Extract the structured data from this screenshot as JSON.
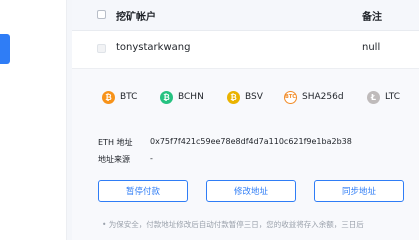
{
  "table": {
    "header": {
      "account": "挖矿帐户",
      "remark": "备注"
    },
    "rows": [
      {
        "account": "tonystarkwang",
        "remark": "null"
      }
    ]
  },
  "coins": [
    {
      "name": "BTC",
      "icon": "bitcoin-icon",
      "color": "#f7931a"
    },
    {
      "name": "BCHN",
      "icon": "bitcoin-cash-icon",
      "color": "#26c281"
    },
    {
      "name": "BSV",
      "icon": "bitcoin-sv-icon",
      "color": "#eab300"
    },
    {
      "name": "SHA256d",
      "icon": "sha256d-icon",
      "color": "#f28c28"
    },
    {
      "name": "LTC",
      "icon": "litecoin-icon",
      "color": "#bfbbbb"
    }
  ],
  "details": {
    "eth_label": "ETH 地址",
    "eth_value": "0x75f7f421c59ee78e8df4d7a110c621f9e1ba2b38",
    "source_label": "地址来源",
    "source_value": "-"
  },
  "buttons": {
    "pause": "暂停付款",
    "modify": "修改地址",
    "sync": "同步地址"
  },
  "notice": "• 为保安全，付款地址修改后自动付款暂停三日，您的收益将存入余额，三日后"
}
